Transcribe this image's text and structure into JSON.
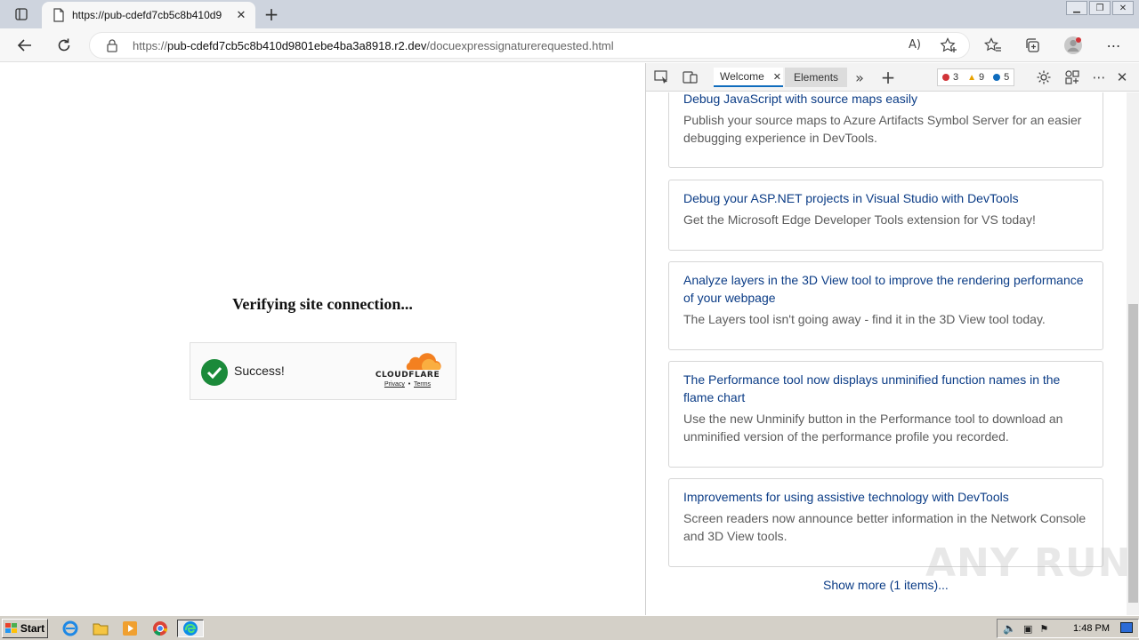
{
  "browser": {
    "tab_title": "https://pub-cdefd7cb5c8b410d9",
    "url_prefix": "https://",
    "url_domain": "pub-cdefd7cb5c8b410d9801ebe4ba3a8918.r2.dev",
    "url_path": "/docuexpressignaturerequested.html",
    "read_aloud_glyph": "A)"
  },
  "page": {
    "heading": "Verifying site connection...",
    "widget": {
      "status": "Success!",
      "brand": "CLOUDFLARE",
      "privacy_link": "Privacy",
      "separator": "•",
      "terms_link": "Terms"
    }
  },
  "devtools": {
    "tabs": [
      {
        "label": "Welcome",
        "active": true
      },
      {
        "label": "Elements",
        "active": false
      }
    ],
    "badges": {
      "errors": "3",
      "warnings": "9",
      "info": "5"
    },
    "cards": [
      {
        "title": "Debug JavaScript with source maps easily",
        "desc": "Publish your source maps to Azure Artifacts Symbol Server for an easier debugging experience in DevTools."
      },
      {
        "title": "Debug your ASP.NET projects in Visual Studio with DevTools",
        "desc": "Get the Microsoft Edge Developer Tools extension for VS today!"
      },
      {
        "title": "Analyze layers in the 3D View tool to improve the rendering performance of your webpage",
        "desc": "The Layers tool isn't going away - find it in the 3D View tool today."
      },
      {
        "title": "The Performance tool now displays unminified function names in the flame chart",
        "desc": "Use the new Unminify button in the Performance tool to download an unminified version of the performance profile you recorded."
      },
      {
        "title": "Improvements for using assistive technology with DevTools",
        "desc": "Screen readers now announce better information in the Network Console and 3D View tools."
      }
    ],
    "show_more": "Show more (1 items)..."
  },
  "watermark": "ANY RUN",
  "taskbar": {
    "start_label": "Start",
    "clock": "1:48 PM"
  },
  "colors": {
    "accent": "#0f6cbd",
    "success": "#1b8a3a",
    "cloudflare_orange": "#f38020",
    "link": "#0b3c86"
  }
}
